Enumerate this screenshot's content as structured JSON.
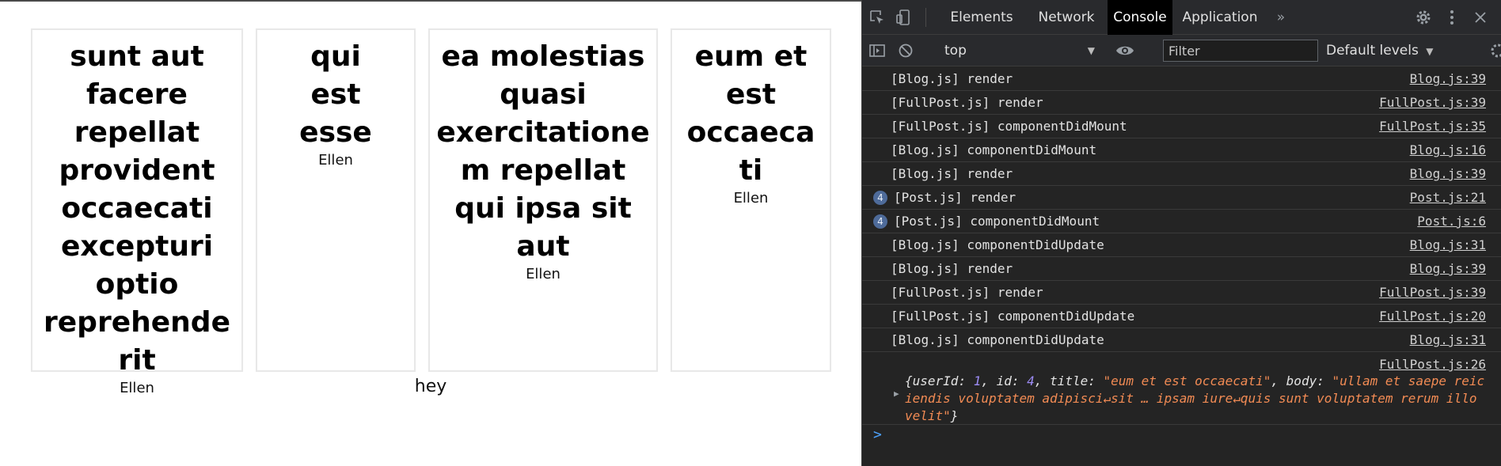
{
  "page": {
    "posts": [
      {
        "title": "sunt aut facere repellat provident occaecati excepturi optio reprehenderit",
        "author": "Ellen"
      },
      {
        "title": "qui est esse",
        "author": "Ellen"
      },
      {
        "title": "ea molestias quasi exercitationem repellat qui ipsa sit aut",
        "author": "Ellen"
      },
      {
        "title": "eum et est occaecati",
        "author": "Ellen"
      }
    ],
    "footer_text": "hey"
  },
  "devtools": {
    "tabs": [
      {
        "label": "Elements"
      },
      {
        "label": "Network"
      },
      {
        "label": "Console",
        "active": true
      },
      {
        "label": "Application"
      }
    ],
    "more_tabs_icon": "»",
    "toolbar": {
      "context": "top",
      "filter_placeholder": "Filter",
      "levels": "Default levels"
    },
    "logs": [
      {
        "msg": "[Blog.js] render",
        "src": "Blog.js:39"
      },
      {
        "msg": "[FullPost.js] render",
        "src": "FullPost.js:39"
      },
      {
        "msg": "[FullPost.js] componentDidMount",
        "src": "FullPost.js:35"
      },
      {
        "msg": "[Blog.js] componentDidMount",
        "src": "Blog.js:16"
      },
      {
        "msg": "[Blog.js] render",
        "src": "Blog.js:39"
      },
      {
        "msg": "[Post.js] render",
        "src": "Post.js:21",
        "count": "4"
      },
      {
        "msg": "[Post.js] componentDidMount",
        "src": "Post.js:6",
        "count": "4"
      },
      {
        "msg": "[Blog.js] componentDidUpdate",
        "src": "Blog.js:31"
      },
      {
        "msg": "[Blog.js] render",
        "src": "Blog.js:39"
      },
      {
        "msg": "[FullPost.js] render",
        "src": "FullPost.js:39"
      },
      {
        "msg": "[FullPost.js] componentDidUpdate",
        "src": "FullPost.js:20"
      },
      {
        "msg": "[Blog.js] componentDidUpdate",
        "src": "Blog.js:31"
      }
    ],
    "object_log": {
      "src": "FullPost.js:26",
      "open": "{",
      "k_userId": "userId: ",
      "v_userId": "1",
      "k_id": ", id: ",
      "v_id": "4",
      "k_title": ", title: ",
      "v_title": "\"eum et est occaecati\"",
      "k_body": ", body: ",
      "v_body": "\"ullam et saepe reiciendis voluptatem adipisci↵sit … ipsam iure↵quis sunt voluptatem rerum illo velit\"",
      "close": "}"
    },
    "prompt": ">"
  }
}
